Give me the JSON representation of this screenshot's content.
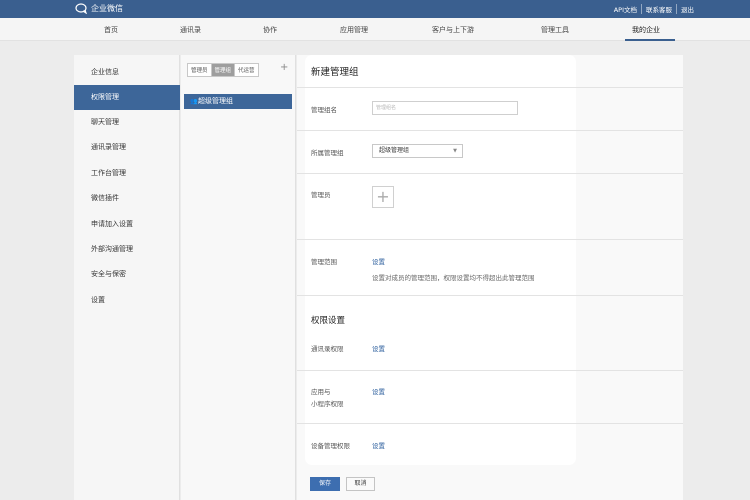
{
  "topbar": {
    "app_name": "企业微信",
    "links": [
      "API文档",
      "联系客服",
      "退出"
    ]
  },
  "nav": {
    "items": [
      "首页",
      "通讯录",
      "协作",
      "应用管理",
      "客户与上下游",
      "管理工具",
      "我的企业"
    ],
    "active": "我的企业"
  },
  "sidebar": {
    "items": [
      "企业信息",
      "权限管理",
      "聊天管理",
      "通讯录管理",
      "工作台管理",
      "微信插件",
      "申请加入设置",
      "外部沟通管理",
      "安全与保密",
      "设置"
    ],
    "active": "权限管理"
  },
  "roles": {
    "tabs": [
      "管理员",
      "管理组",
      "代运营"
    ],
    "active_tab": "管理组",
    "add_label": "+",
    "groups": [
      "超级管理组"
    ]
  },
  "form": {
    "title": "新建管理组",
    "name_label": "管理组名",
    "name_placeholder": "管理组名",
    "parent_label": "所属管理组",
    "parent_value": "超级管理组",
    "admins_label": "管理员",
    "admins_add": "+",
    "scope_label": "管理范围",
    "scope_link": "设置",
    "scope_desc": "设置对成员的管理范围，权限设置均不得超出此管理范围",
    "perm_title": "权限设置",
    "contacts_perm_label": "通讯录权限",
    "contacts_perm_link": "设置",
    "app_perm_label_line1": "应用与",
    "app_perm_label_line2": "小程序权限",
    "app_perm_link": "设置",
    "device_perm_label": "设备管理权限",
    "device_perm_link": "设置"
  },
  "actions": {
    "save": "保存",
    "cancel": "取消"
  },
  "colors": {
    "topbar": "#3a5f8f",
    "accent": "#3d6699",
    "link": "#2a5d9c",
    "primary_button": "#3d6eb0"
  }
}
